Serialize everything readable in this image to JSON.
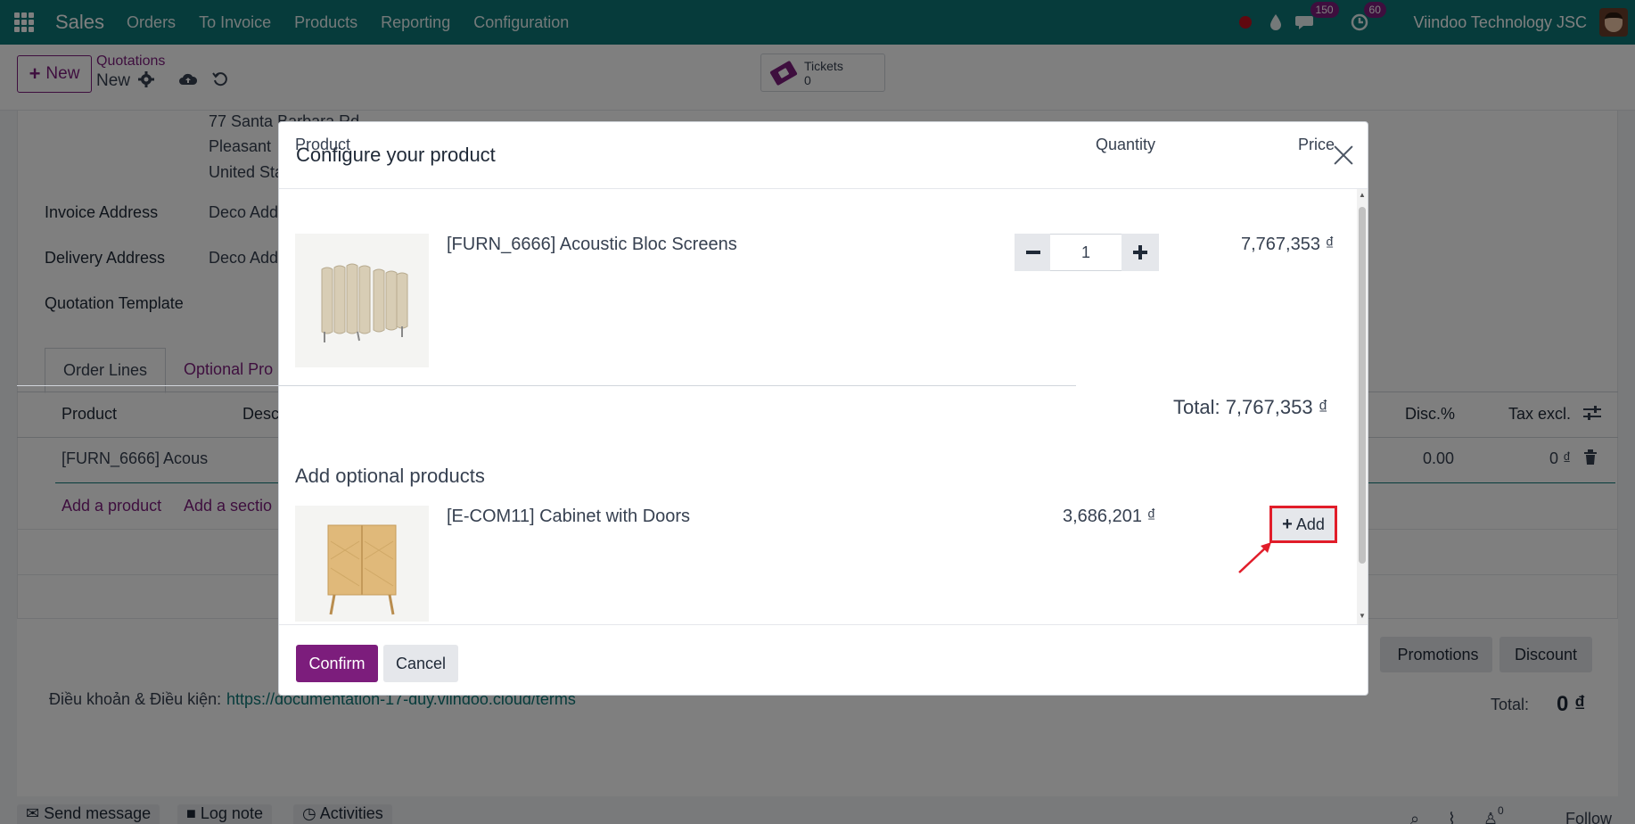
{
  "navbar": {
    "brand": "Sales",
    "menu": [
      "Orders",
      "To Invoice",
      "Products",
      "Reporting",
      "Configuration"
    ],
    "messages_badge": "150",
    "activities_badge": "60",
    "company": "Viindoo Technology JSC",
    "recording_color": "#c0111f"
  },
  "control": {
    "new_label": "New",
    "breadcrumb_parent": "Quotations",
    "breadcrumb_current": "New",
    "tickets_label": "Tickets",
    "tickets_count": "0"
  },
  "form": {
    "address_line1": "77 Santa Barbara Rd",
    "address_line2": "Pleasant",
    "address_line3": "United Sta",
    "invoice_address_label": "Invoice Address",
    "invoice_address_value": "Deco Add",
    "delivery_address_label": "Delivery Address",
    "delivery_address_value": "Deco Add",
    "quotation_template_label": "Quotation Template",
    "tab_order_lines": "Order Lines",
    "tab_optional": "Optional Pro",
    "col_product": "Product",
    "col_desc": "Desc",
    "col_disc": "Disc.%",
    "col_tax_excl": "Tax excl.",
    "line_product": "[FURN_6666] Acous",
    "line_disc": "0.00",
    "line_tax_excl": "0 ₫",
    "add_product": "Add a product",
    "add_section": "Add a sectio",
    "promotions_label": "Promotions",
    "discount_label": "Discount",
    "terms_label": "Điều khoản & Điều kiện:",
    "terms_link": "https://documentation-17-duy.viindoo.cloud/terms",
    "total_label": "Total:",
    "total_value": "0 ₫",
    "send_message": "Send message",
    "log_note": "Log note",
    "activities": "Activities",
    "follow": "Follow",
    "followers_count": "0"
  },
  "modal": {
    "title": "Configure your product",
    "col_product": "Product",
    "col_quantity": "Quantity",
    "col_price": "Price",
    "main_product": {
      "name": "[FURN_6666] Acoustic Bloc Screens",
      "quantity": "1",
      "price": "7,767,353 ₫"
    },
    "total_text": "Total: 7,767,353 ₫",
    "optional_heading": "Add optional products",
    "optional_product": {
      "name": "[E-COM11] Cabinet with Doors",
      "price": "3,686,201 ₫",
      "add_label": "Add"
    },
    "confirm_label": "Confirm",
    "cancel_label": "Cancel"
  },
  "colors": {
    "navbar": "#0d7777",
    "primary": "#7c1d7c",
    "highlight": "#e11d2a"
  }
}
